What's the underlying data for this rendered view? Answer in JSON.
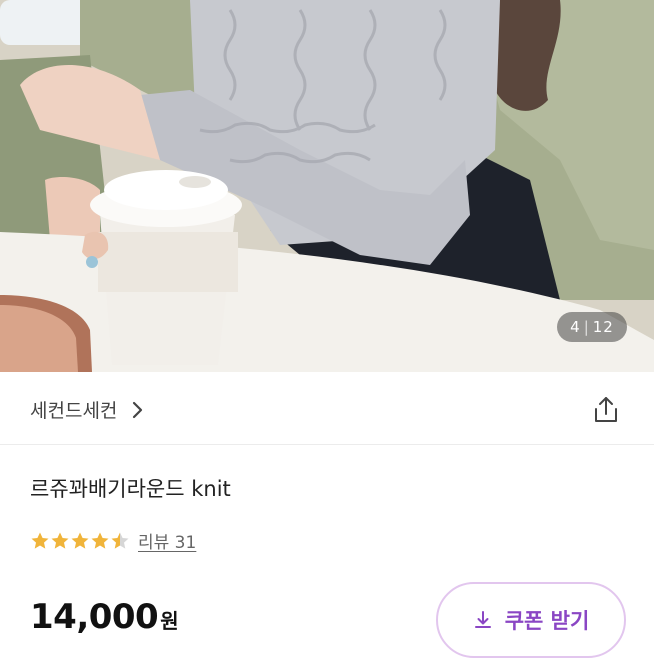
{
  "gallery": {
    "current": "4",
    "separator": "|",
    "total": "12"
  },
  "brand": {
    "name": "세컨드세컨",
    "icons": {
      "chevron": "chevron-right-icon",
      "share": "share-icon"
    }
  },
  "product": {
    "title": "르쥬꽈배기라운드 knit",
    "rating": 4.5,
    "review_label": "리뷰 31",
    "price": "14,000",
    "price_unit": "원"
  },
  "coupon": {
    "label": "쿠폰 받기",
    "icon": "download-icon"
  },
  "colors": {
    "star": "#f0b43a",
    "coupon_border": "#e2c6ee",
    "coupon_text": "#8a46c4"
  }
}
